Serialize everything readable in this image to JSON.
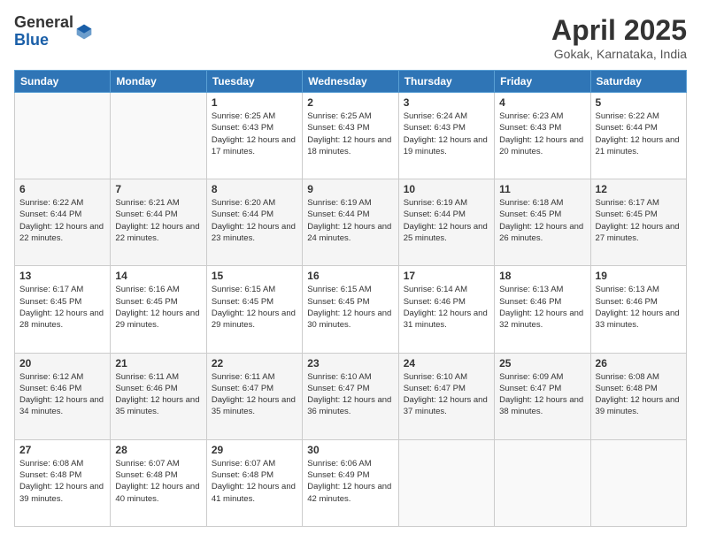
{
  "header": {
    "logo_general": "General",
    "logo_blue": "Blue",
    "title": "April 2025",
    "location": "Gokak, Karnataka, India"
  },
  "days_of_week": [
    "Sunday",
    "Monday",
    "Tuesday",
    "Wednesday",
    "Thursday",
    "Friday",
    "Saturday"
  ],
  "weeks": [
    [
      {
        "day": "",
        "sunrise": "",
        "sunset": "",
        "daylight": ""
      },
      {
        "day": "",
        "sunrise": "",
        "sunset": "",
        "daylight": ""
      },
      {
        "day": "1",
        "sunrise": "Sunrise: 6:25 AM",
        "sunset": "Sunset: 6:43 PM",
        "daylight": "Daylight: 12 hours and 17 minutes."
      },
      {
        "day": "2",
        "sunrise": "Sunrise: 6:25 AM",
        "sunset": "Sunset: 6:43 PM",
        "daylight": "Daylight: 12 hours and 18 minutes."
      },
      {
        "day": "3",
        "sunrise": "Sunrise: 6:24 AM",
        "sunset": "Sunset: 6:43 PM",
        "daylight": "Daylight: 12 hours and 19 minutes."
      },
      {
        "day": "4",
        "sunrise": "Sunrise: 6:23 AM",
        "sunset": "Sunset: 6:43 PM",
        "daylight": "Daylight: 12 hours and 20 minutes."
      },
      {
        "day": "5",
        "sunrise": "Sunrise: 6:22 AM",
        "sunset": "Sunset: 6:44 PM",
        "daylight": "Daylight: 12 hours and 21 minutes."
      }
    ],
    [
      {
        "day": "6",
        "sunrise": "Sunrise: 6:22 AM",
        "sunset": "Sunset: 6:44 PM",
        "daylight": "Daylight: 12 hours and 22 minutes."
      },
      {
        "day": "7",
        "sunrise": "Sunrise: 6:21 AM",
        "sunset": "Sunset: 6:44 PM",
        "daylight": "Daylight: 12 hours and 22 minutes."
      },
      {
        "day": "8",
        "sunrise": "Sunrise: 6:20 AM",
        "sunset": "Sunset: 6:44 PM",
        "daylight": "Daylight: 12 hours and 23 minutes."
      },
      {
        "day": "9",
        "sunrise": "Sunrise: 6:19 AM",
        "sunset": "Sunset: 6:44 PM",
        "daylight": "Daylight: 12 hours and 24 minutes."
      },
      {
        "day": "10",
        "sunrise": "Sunrise: 6:19 AM",
        "sunset": "Sunset: 6:44 PM",
        "daylight": "Daylight: 12 hours and 25 minutes."
      },
      {
        "day": "11",
        "sunrise": "Sunrise: 6:18 AM",
        "sunset": "Sunset: 6:45 PM",
        "daylight": "Daylight: 12 hours and 26 minutes."
      },
      {
        "day": "12",
        "sunrise": "Sunrise: 6:17 AM",
        "sunset": "Sunset: 6:45 PM",
        "daylight": "Daylight: 12 hours and 27 minutes."
      }
    ],
    [
      {
        "day": "13",
        "sunrise": "Sunrise: 6:17 AM",
        "sunset": "Sunset: 6:45 PM",
        "daylight": "Daylight: 12 hours and 28 minutes."
      },
      {
        "day": "14",
        "sunrise": "Sunrise: 6:16 AM",
        "sunset": "Sunset: 6:45 PM",
        "daylight": "Daylight: 12 hours and 29 minutes."
      },
      {
        "day": "15",
        "sunrise": "Sunrise: 6:15 AM",
        "sunset": "Sunset: 6:45 PM",
        "daylight": "Daylight: 12 hours and 29 minutes."
      },
      {
        "day": "16",
        "sunrise": "Sunrise: 6:15 AM",
        "sunset": "Sunset: 6:45 PM",
        "daylight": "Daylight: 12 hours and 30 minutes."
      },
      {
        "day": "17",
        "sunrise": "Sunrise: 6:14 AM",
        "sunset": "Sunset: 6:46 PM",
        "daylight": "Daylight: 12 hours and 31 minutes."
      },
      {
        "day": "18",
        "sunrise": "Sunrise: 6:13 AM",
        "sunset": "Sunset: 6:46 PM",
        "daylight": "Daylight: 12 hours and 32 minutes."
      },
      {
        "day": "19",
        "sunrise": "Sunrise: 6:13 AM",
        "sunset": "Sunset: 6:46 PM",
        "daylight": "Daylight: 12 hours and 33 minutes."
      }
    ],
    [
      {
        "day": "20",
        "sunrise": "Sunrise: 6:12 AM",
        "sunset": "Sunset: 6:46 PM",
        "daylight": "Daylight: 12 hours and 34 minutes."
      },
      {
        "day": "21",
        "sunrise": "Sunrise: 6:11 AM",
        "sunset": "Sunset: 6:46 PM",
        "daylight": "Daylight: 12 hours and 35 minutes."
      },
      {
        "day": "22",
        "sunrise": "Sunrise: 6:11 AM",
        "sunset": "Sunset: 6:47 PM",
        "daylight": "Daylight: 12 hours and 35 minutes."
      },
      {
        "day": "23",
        "sunrise": "Sunrise: 6:10 AM",
        "sunset": "Sunset: 6:47 PM",
        "daylight": "Daylight: 12 hours and 36 minutes."
      },
      {
        "day": "24",
        "sunrise": "Sunrise: 6:10 AM",
        "sunset": "Sunset: 6:47 PM",
        "daylight": "Daylight: 12 hours and 37 minutes."
      },
      {
        "day": "25",
        "sunrise": "Sunrise: 6:09 AM",
        "sunset": "Sunset: 6:47 PM",
        "daylight": "Daylight: 12 hours and 38 minutes."
      },
      {
        "day": "26",
        "sunrise": "Sunrise: 6:08 AM",
        "sunset": "Sunset: 6:48 PM",
        "daylight": "Daylight: 12 hours and 39 minutes."
      }
    ],
    [
      {
        "day": "27",
        "sunrise": "Sunrise: 6:08 AM",
        "sunset": "Sunset: 6:48 PM",
        "daylight": "Daylight: 12 hours and 39 minutes."
      },
      {
        "day": "28",
        "sunrise": "Sunrise: 6:07 AM",
        "sunset": "Sunset: 6:48 PM",
        "daylight": "Daylight: 12 hours and 40 minutes."
      },
      {
        "day": "29",
        "sunrise": "Sunrise: 6:07 AM",
        "sunset": "Sunset: 6:48 PM",
        "daylight": "Daylight: 12 hours and 41 minutes."
      },
      {
        "day": "30",
        "sunrise": "Sunrise: 6:06 AM",
        "sunset": "Sunset: 6:49 PM",
        "daylight": "Daylight: 12 hours and 42 minutes."
      },
      {
        "day": "",
        "sunrise": "",
        "sunset": "",
        "daylight": ""
      },
      {
        "day": "",
        "sunrise": "",
        "sunset": "",
        "daylight": ""
      },
      {
        "day": "",
        "sunrise": "",
        "sunset": "",
        "daylight": ""
      }
    ]
  ]
}
